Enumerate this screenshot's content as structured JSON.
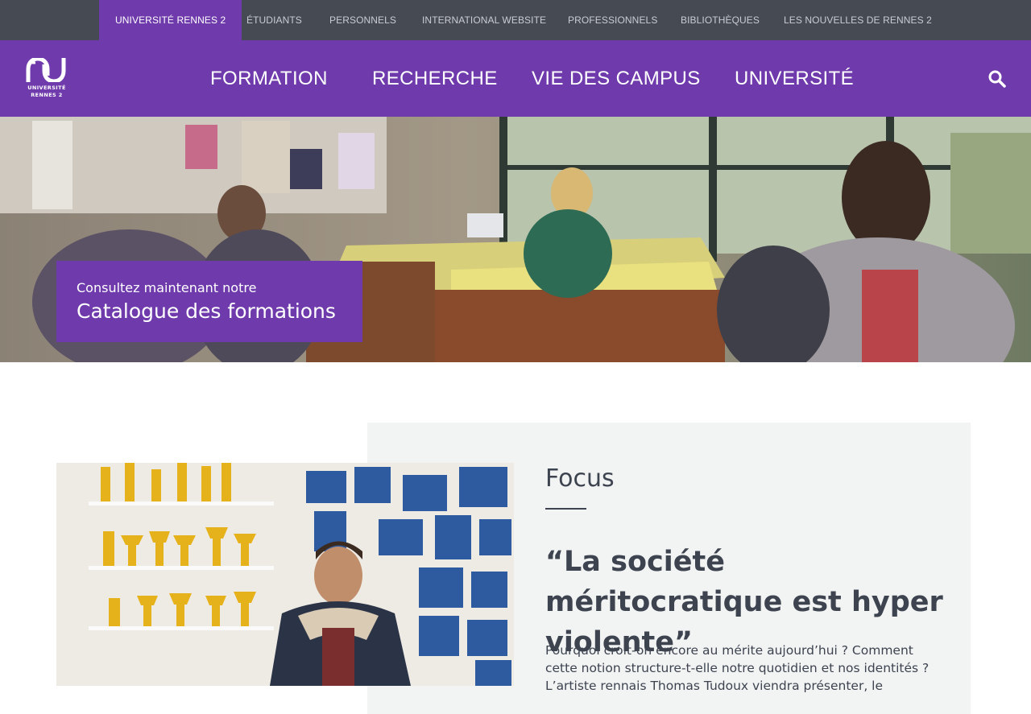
{
  "topbar": {
    "links": [
      {
        "label": "UNIVERSITÉ RENNES 2",
        "active": true
      },
      {
        "label": "ÉTUDIANTS"
      },
      {
        "label": "PERSONNELS"
      },
      {
        "label": "INTERNATIONAL WEBSITE"
      },
      {
        "label": "PROFESSIONNELS"
      },
      {
        "label": "BIBLIOTHÈQUES"
      },
      {
        "label": "LES NOUVELLES DE RENNES 2"
      }
    ]
  },
  "header": {
    "logo_text": [
      "UNIVERSITÉ",
      "RENNES 2"
    ],
    "nav": [
      {
        "label": "FORMATION"
      },
      {
        "label": "RECHERCHE"
      },
      {
        "label": "VIE DES CAMPUS"
      },
      {
        "label": "UNIVERSITÉ"
      }
    ],
    "search_icon": "search-icon"
  },
  "hero": {
    "small": "Consultez maintenant notre",
    "big": "Catalogue des formations"
  },
  "focus": {
    "label": "Focus",
    "title": "“La société méritocratique est hyper violente”",
    "text": "Pourquoi croit-on encore au mérite aujourd’hui ? Comment cette notion structure-t-elle notre quotidien et nos identités ? L’artiste rennais Thomas Tudoux viendra présenter, le"
  },
  "colors": {
    "brand_purple": "#6f3aab",
    "topbar_gray": "#464a52",
    "focus_bg": "#f2f3f3",
    "text_dark": "#3d4450"
  }
}
